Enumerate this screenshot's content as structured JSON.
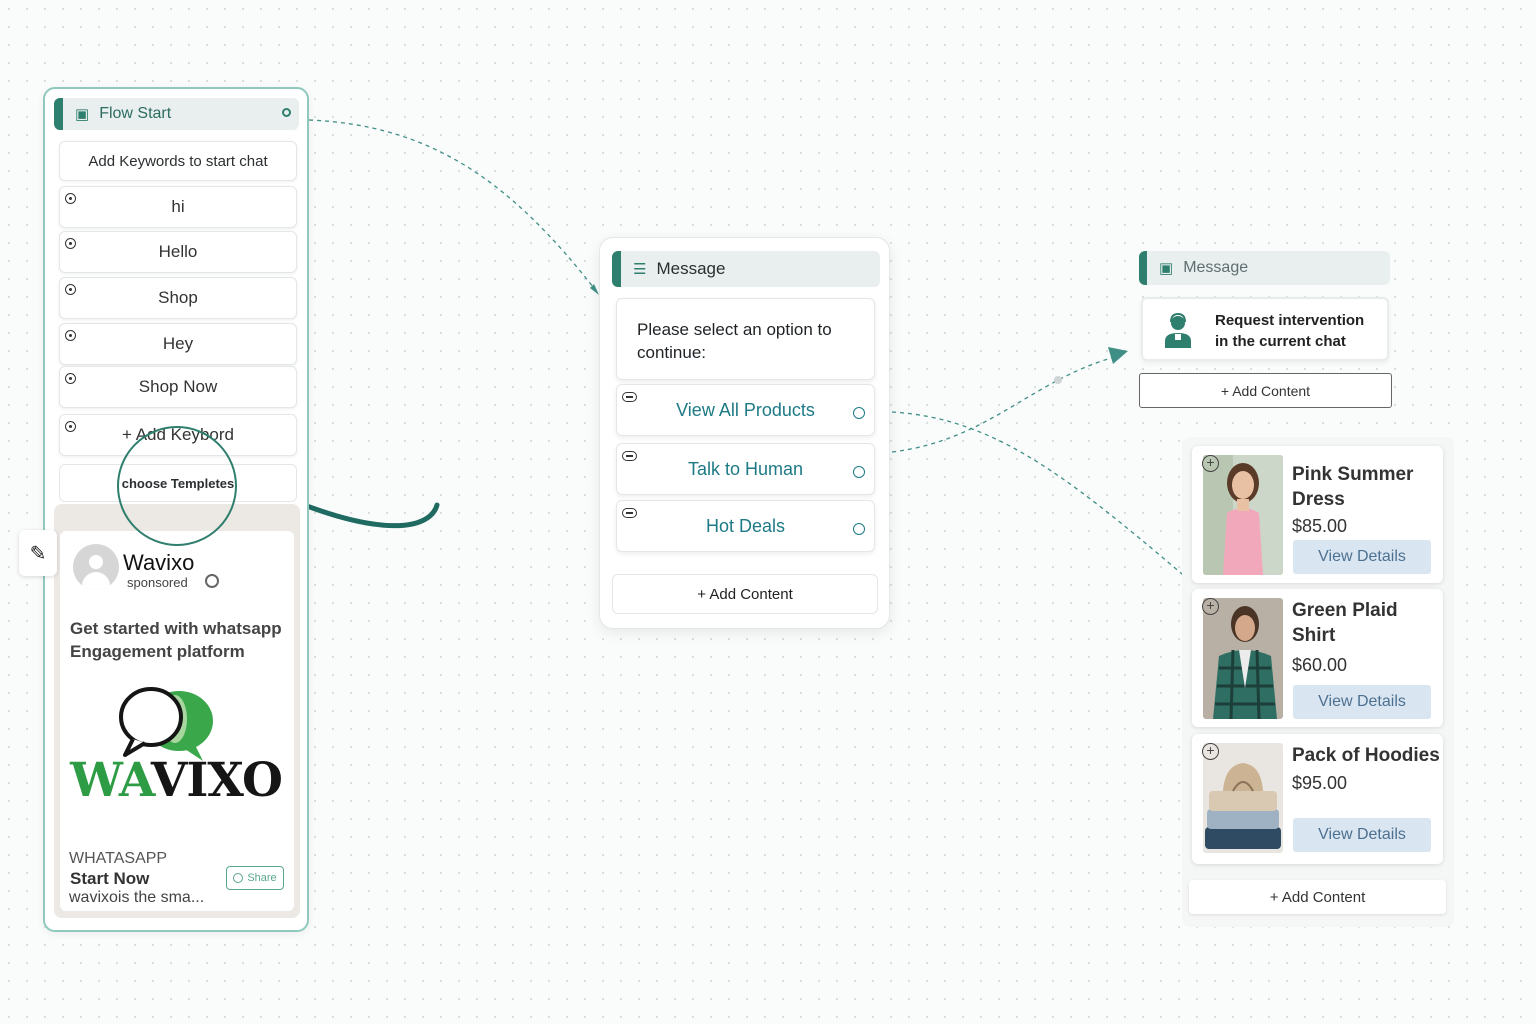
{
  "colors": {
    "accent": "#2f7f6e",
    "node_border": "#8fc9bd",
    "button_text": "#1d7a86",
    "view_button_bg": "#d9e6f1",
    "logo_green": "#2e9b45"
  },
  "flow_start": {
    "title": "Flow Start",
    "icon": "window-icon",
    "keywords_title": "Add Keywords to start chat",
    "keywords": [
      "hi",
      "Hello",
      "Shop",
      "Hey",
      "Shop Now"
    ],
    "add_keyword_label": "+ Add Keybord",
    "templates_label": "choose Templetes"
  },
  "ad_preview": {
    "name": "Wavixo",
    "sponsored": "sponsored",
    "headline": "Get started with whatsapp Engagement platform",
    "logo_text_green": "WA",
    "logo_text_dark": "VIXO",
    "source": "WHATASAPP",
    "cta": "Start Now",
    "description": "wavixois the sma...",
    "share_label": "Share"
  },
  "message_node": {
    "title": "Message",
    "icon": "list-icon",
    "body": "Please select an option to continue:",
    "buttons": [
      {
        "label": "View All Products"
      },
      {
        "label": "Talk to Human"
      },
      {
        "label": "Hot Deals"
      }
    ],
    "add_content": "+ Add Content"
  },
  "right_message": {
    "title": "Message",
    "icon": "window-icon",
    "line1": "Request intervention",
    "line2": "in the current chat",
    "add_content": "+ Add Content"
  },
  "products": {
    "items": [
      {
        "name_line1": "Pink Summer",
        "name_line2": "Dress",
        "price": "$85.00",
        "button": "View Details"
      },
      {
        "name_line1": "Green Plaid",
        "name_line2": "Shirt",
        "price": "$60.00",
        "button": "View Details"
      },
      {
        "name_line1": "Pack of Hoodies",
        "name_line2": "",
        "price": "$95.00",
        "button": "View Details"
      }
    ],
    "add_content": "+ Add Content"
  }
}
